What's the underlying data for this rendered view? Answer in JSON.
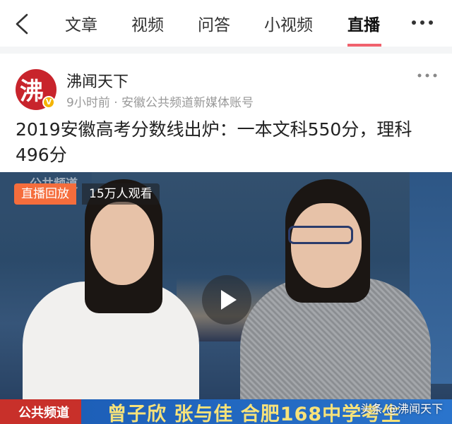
{
  "topnav": {
    "tabs": [
      {
        "label": "文章"
      },
      {
        "label": "视频"
      },
      {
        "label": "问答"
      },
      {
        "label": "小视频"
      },
      {
        "label": "直播",
        "active": true
      }
    ],
    "back_icon": "chevron-left-icon",
    "more_icon": "more-horizontal-icon",
    "accent_color": "#f0616d"
  },
  "article": {
    "avatar_char": "沸",
    "verified_mark": "V",
    "author": "沸闻天下",
    "meta": "9小时前 · 安徽公共频道新媒体账号",
    "title": "2019安徽高考分数线出炉：一本文科550分，理科496分"
  },
  "video": {
    "live_badge": "直播回放",
    "views": "15万人观看",
    "channel_faint": "公共频道",
    "lower_channel": "公共频道",
    "lower_names": "曾子欣 张与佳  合肥168中学考生",
    "watermark": "头条 @沸闻天下",
    "badge_color": "#f56d3c"
  }
}
